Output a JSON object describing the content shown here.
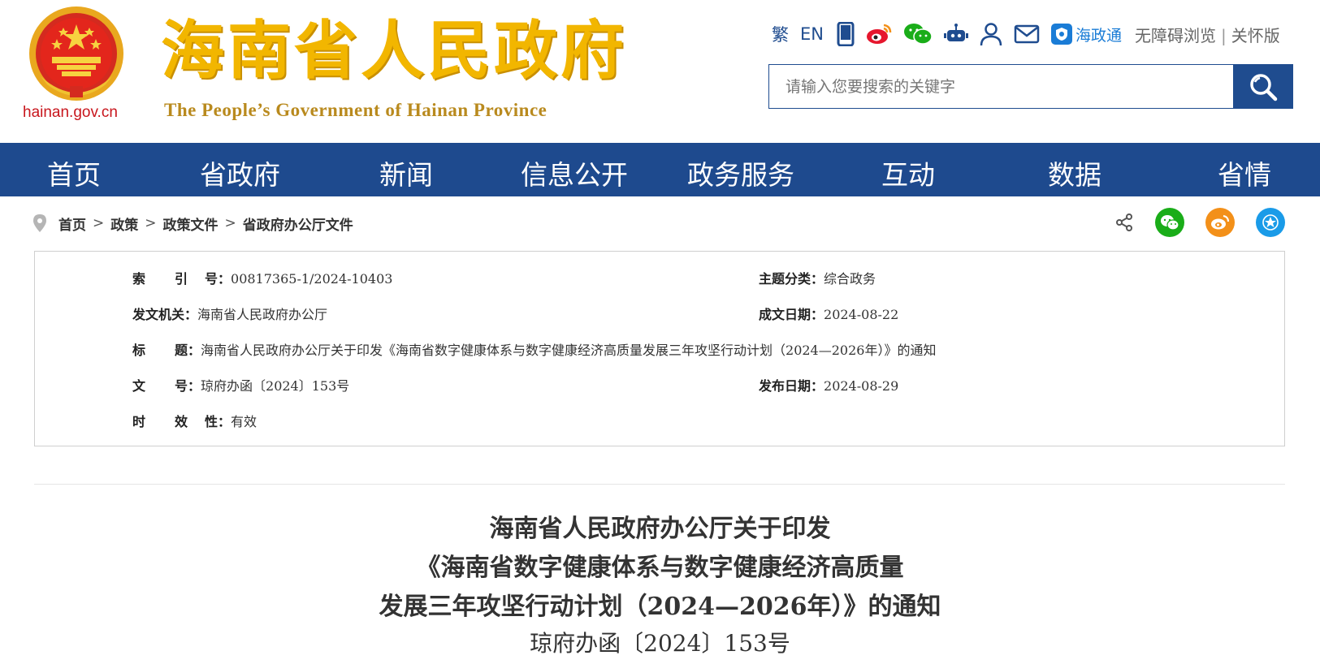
{
  "header": {
    "domain": "hainan.gov.cn",
    "title": "海南省人民政府",
    "subtitle": "The People’s Government  of Hainan Province",
    "traditional": "繁",
    "english": "EN",
    "haizhengtong": "海政通",
    "accessible": "无障碍浏览",
    "separator": "|",
    "care_mode": "关怀版",
    "search_placeholder": "请输入您要搜索的关键字"
  },
  "nav": [
    "首页",
    "省政府",
    "新闻",
    "信息公开",
    "政务服务",
    "互动",
    "数据",
    "省情"
  ],
  "breadcrumb": [
    "首页",
    "政策",
    "政策文件",
    "省政府办公厅文件"
  ],
  "breadcrumb_sep": ">",
  "info": {
    "index_label_chars": [
      "索",
      "引",
      "号："
    ],
    "index_value": "00817365-1/2024-10403",
    "topic_label": "主题分类：",
    "topic_value": "综合政务",
    "issuer_label": "发文机关：",
    "issuer_value": "海南省人民政府办公厅",
    "date_label": "成文日期：",
    "date_value": "2024-08-22",
    "title_label_chars": [
      "标",
      "题："
    ],
    "title_value": "海南省人民政府办公厅关于印发《海南省数字健康体系与数字健康经济高质量发展三年攻坚行动计划（2024—2026年）》的通知",
    "docno_label_chars": [
      "文",
      "号："
    ],
    "docno_value": "琼府办函〔2024〕153号",
    "publish_label": "发布日期：",
    "publish_value": "2024-08-29",
    "validity_label_chars": [
      "时",
      "效",
      "性："
    ],
    "validity_value": "有效"
  },
  "document": {
    "title_lines": [
      "海南省人民政府办公厅关于印发",
      "《海南省数字健康体系与数字健康经济高质量",
      "发展三年攻坚行动计划（2024—2026年）》的通知"
    ],
    "doc_number": "琼府办函〔2024〕153号"
  },
  "colors": {
    "nav_blue": "#1e4a8e",
    "title_gold": "#f2b600",
    "wechat_green": "#1aad19",
    "weibo_orange": "#f39019",
    "favorite_blue": "#1a9be8"
  }
}
